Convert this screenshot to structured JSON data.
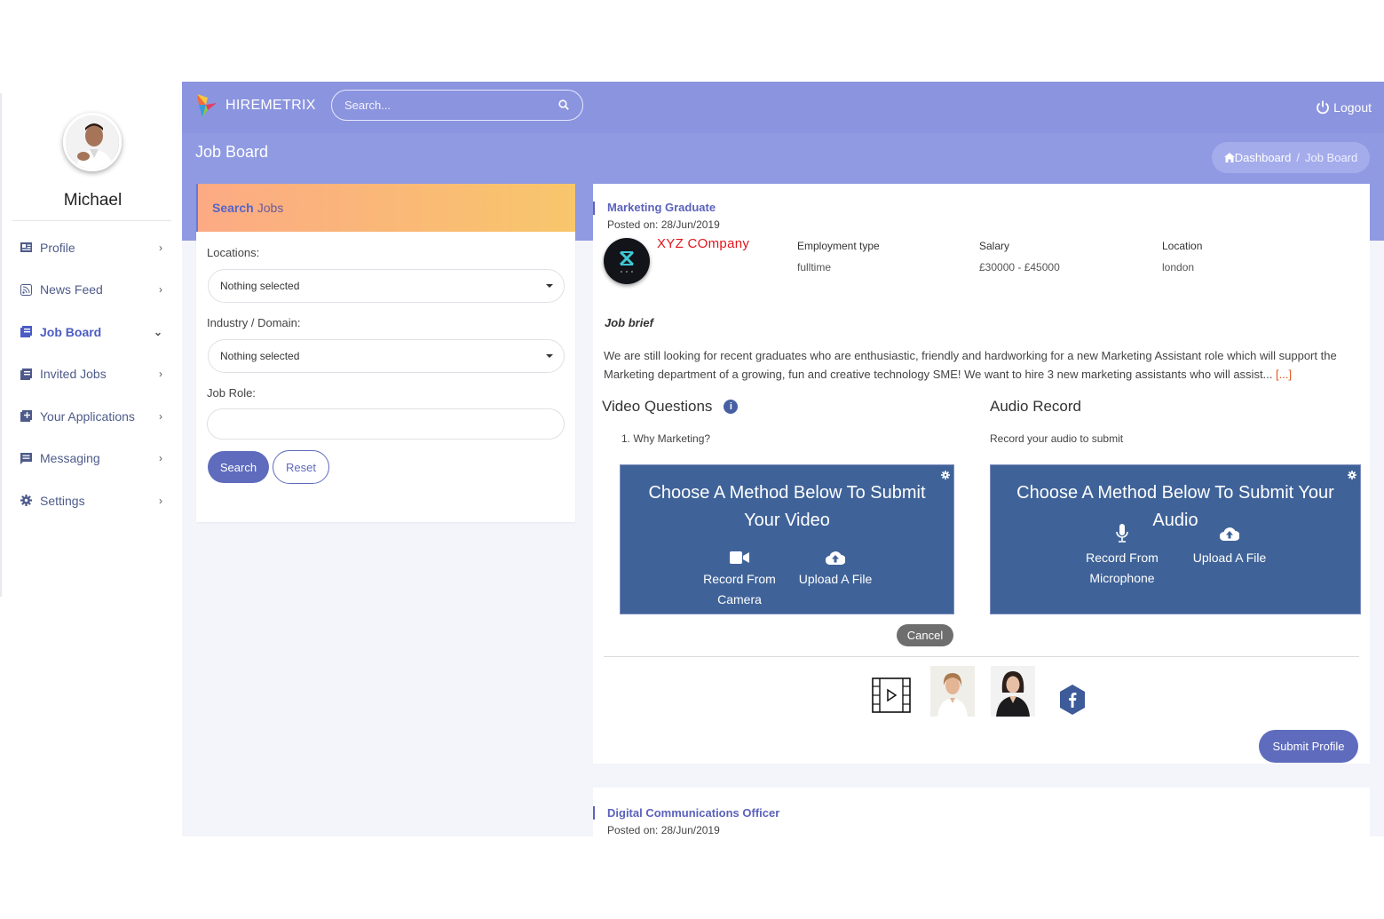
{
  "app": {
    "brand": "HIREMETRIX",
    "search_placeholder": "Search...",
    "logout": "Logout"
  },
  "user": {
    "name": "Michael"
  },
  "sidebar": {
    "items": [
      {
        "label": "Profile",
        "icon": "profile-card-icon"
      },
      {
        "label": "News Feed",
        "icon": "rss-feed-icon"
      },
      {
        "label": "Job Board",
        "icon": "job-board-icon",
        "active": true
      },
      {
        "label": "Invited Jobs",
        "icon": "invited-jobs-icon"
      },
      {
        "label": "Your Applications",
        "icon": "applications-icon"
      },
      {
        "label": "Messaging",
        "icon": "message-icon"
      },
      {
        "label": "Settings",
        "icon": "gear-icon"
      }
    ]
  },
  "header": {
    "page_title": "Job Board",
    "breadcrumb": {
      "home": "Dashboard",
      "separator": "/",
      "current": "Job Board"
    }
  },
  "search_jobs": {
    "title_bold": "Search",
    "title_rest": "Jobs",
    "locations_label": "Locations:",
    "locations_value": "Nothing selected",
    "industry_label": "Industry / Domain:",
    "industry_value": "Nothing selected",
    "role_label": "Job Role:",
    "role_value": "",
    "search_button": "Search",
    "reset_button": "Reset"
  },
  "job": {
    "title": "Marketing Graduate",
    "posted": "Posted on: 28/Jun/2019",
    "company": "XYZ COmpany",
    "employment_type_label": "Employment type",
    "employment_type": "fulltime",
    "salary_label": "Salary",
    "salary": "£30000 - £45000",
    "location_label": "Location",
    "location": "london",
    "brief_heading": "Job brief",
    "brief": "We are still looking for recent graduates who are enthusiastic, friendly and hardworking for a new Marketing Assistant role which will support the Marketing department of a growing, fun and creative technology SME! We want to hire 3 new marketing assistants who will assist...",
    "brief_more": "[...]",
    "video_questions_title": "Video Questions",
    "video_question_1": "1. Why Marketing?",
    "audio_title": "Audio Record",
    "audio_subtitle": "Record your audio to submit",
    "video_box": {
      "title": "Choose A Method Below To Submit Your Video",
      "option_camera": "Record From Camera",
      "option_upload": "Upload A File"
    },
    "audio_box": {
      "title": "Choose A Method Below To Submit Your Audio",
      "option_mic": "Record From Microphone",
      "option_upload": "Upload A File"
    },
    "cancel_button": "Cancel",
    "submit_button": "Submit Profile"
  },
  "job2": {
    "title": "Digital Communications Officer",
    "posted": "Posted on: 28/Jun/2019"
  },
  "colors": {
    "topbar": "#8b94de",
    "accent": "#5f6cbd",
    "recorder": "#3f6399",
    "company": "#e2141b"
  }
}
